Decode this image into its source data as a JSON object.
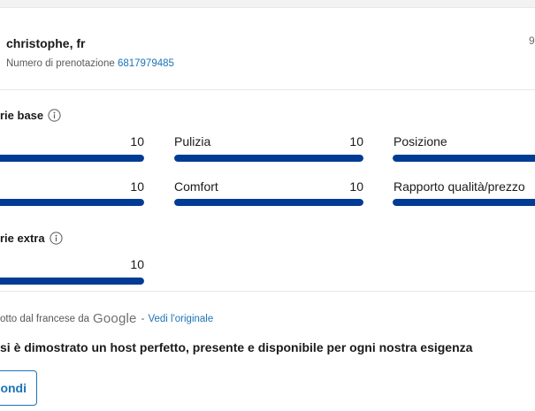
{
  "reviewer": {
    "name": "christophe, fr",
    "booking_label": "Numero di prenotazione",
    "booking_number": "6817979485",
    "score_peek": "9"
  },
  "basic_section": {
    "title": "rie base",
    "info_icon": "info-icon",
    "categories": [
      {
        "label": "",
        "score": "10",
        "fill": 1.0
      },
      {
        "label": "Pulizia",
        "score": "10",
        "fill": 1.0
      },
      {
        "label": "Posizione",
        "score": "",
        "fill": 1.0
      },
      {
        "label": "",
        "score": "10",
        "fill": 1.0
      },
      {
        "label": "Comfort",
        "score": "10",
        "fill": 1.0
      },
      {
        "label": "Rapporto qualità/prezzo",
        "score": "",
        "fill": 1.0
      }
    ]
  },
  "extra_section": {
    "title": "rie extra",
    "info_icon": "info-icon",
    "categories": [
      {
        "label": "",
        "score": "10",
        "fill": 1.0
      }
    ]
  },
  "translation": {
    "prefix": "otto dal francese da",
    "provider": "Google",
    "separator": "-",
    "see_original": "Vedi l'originale"
  },
  "review": {
    "text": "si è dimostrato un host perfetto, presente e disponibile per ogni nostra esigenza"
  },
  "actions": {
    "reply_label": "ondi"
  },
  "colors": {
    "bar": "#003b95",
    "link": "#1a73b8"
  }
}
